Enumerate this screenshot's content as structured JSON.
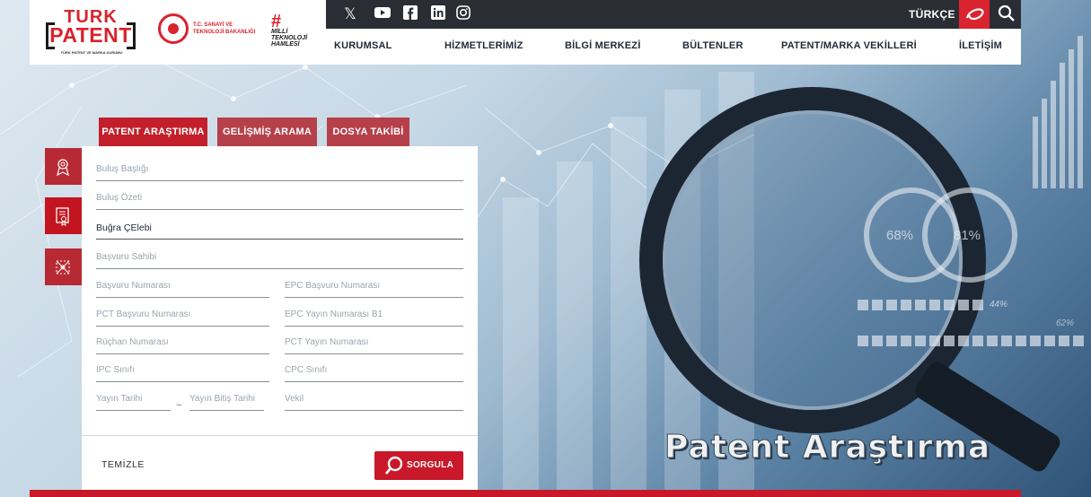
{
  "brand": {
    "logo_line1": "TURK",
    "logo_line2": "PATENT",
    "logo_sub": "TÜRK PATENT VE MARKA KURUMU",
    "ministry": "T.C. SANAYİ VE TEKNOLOJİ BAKANLIĞI",
    "milli_line": "MİLLİ TEKNOLOJİ HAMLESİ"
  },
  "topbar": {
    "social_icons": [
      "x-icon",
      "youtube-icon",
      "facebook-icon",
      "linkedin-icon",
      "instagram-icon"
    ],
    "language": "TÜRKÇE"
  },
  "nav": {
    "items": [
      "KURUMSAL",
      "HİZMETLERİMİZ",
      "BİLGİ MERKEZİ",
      "BÜLTENLER",
      "PATENT/MARKA VEKİLLERİ",
      "İLETİŞİM"
    ]
  },
  "tabs": [
    "PATENT ARAŞTIRMA",
    "GELİŞMİŞ ARAMA",
    "DOSYA TAKİBİ"
  ],
  "form": {
    "invention_title": "Buluş Başlığı",
    "invention_summary": "Buluş Özeti",
    "inventor_value": "Buğra ÇElebi",
    "applicant": "Başvuru Sahibi",
    "application_number": "Başvuru Numarası",
    "epc_application_number": "EPC Başvuru Numarası",
    "pct_application_number": "PCT Başvuru Numarası",
    "epc_publication_number": "EPC Yayın Numarası B1",
    "priority_number": "Rüçhan Numarası",
    "pct_publication_number": "PCT Yayın Numarası",
    "ipc_class": "IPC Sınıfı",
    "cpc_class": "CPC Sınıfı",
    "publication_date": "Yayın Tarihi",
    "tilde": "~",
    "publication_end_date": "Yayın Bitiş Tarihi",
    "attorney": "Vekil",
    "clear_label": "TEMİZLE",
    "query_label": "SORGULA"
  },
  "banner": {
    "title": "Patent Araştırma",
    "stat1": "68%",
    "stat2": "81%",
    "stat3": "44%",
    "stat4": "62%"
  },
  "colors": {
    "accent_red": "#c8182a",
    "topbar_dark": "#2a2d33",
    "nav_text": "#1f2a36"
  }
}
